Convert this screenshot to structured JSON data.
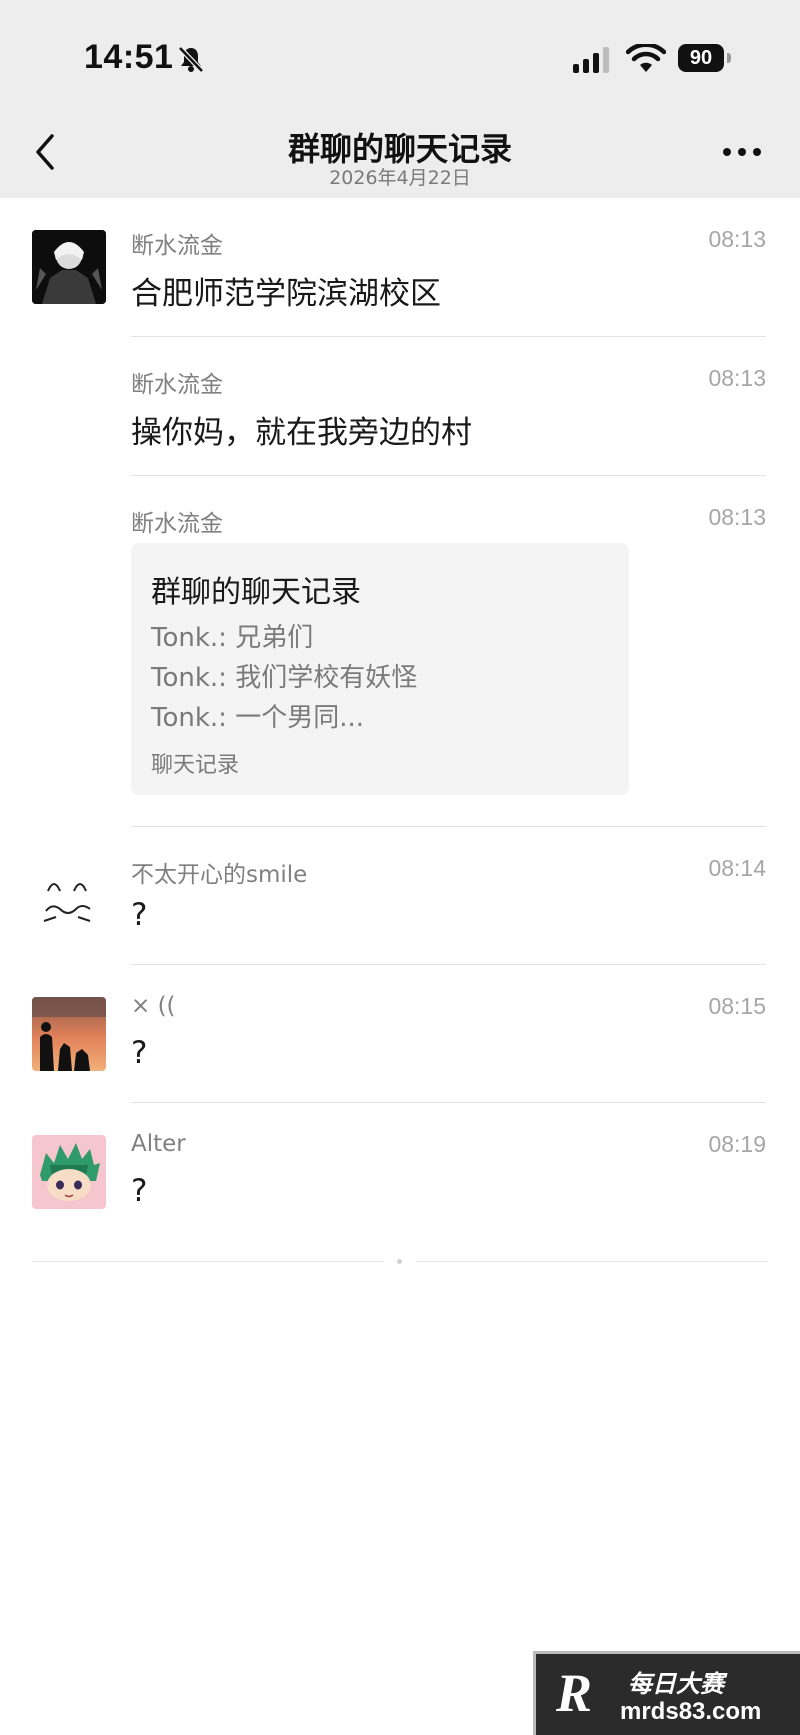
{
  "status_bar": {
    "time": "14:51",
    "battery": "90"
  },
  "nav": {
    "title": "群聊的聊天记录",
    "subtitle": "2026年4月22日"
  },
  "messages": [
    {
      "sender": "断水流金",
      "time": "08:13",
      "text": "合肥师范学院滨湖校区"
    },
    {
      "sender": "断水流金",
      "time": "08:13",
      "text": "操你妈，就在我旁边的村"
    },
    {
      "sender": "断水流金",
      "time": "08:13",
      "card": {
        "title": "群聊的聊天记录",
        "lines": [
          "Tonk.: 兄弟们",
          "Tonk.: 我们学校有妖怪",
          "Tonk.: 一个男同..."
        ],
        "footer": "聊天记录"
      }
    },
    {
      "sender": "不太开心的smile",
      "time": "08:14",
      "text": "?"
    },
    {
      "sender": "× ((",
      "time": "08:15",
      "text": "?"
    },
    {
      "sender": "Alter",
      "time": "08:19",
      "text": "?"
    }
  ],
  "watermark": {
    "brand_cn": "每日大赛",
    "url": "mrds83.com"
  }
}
